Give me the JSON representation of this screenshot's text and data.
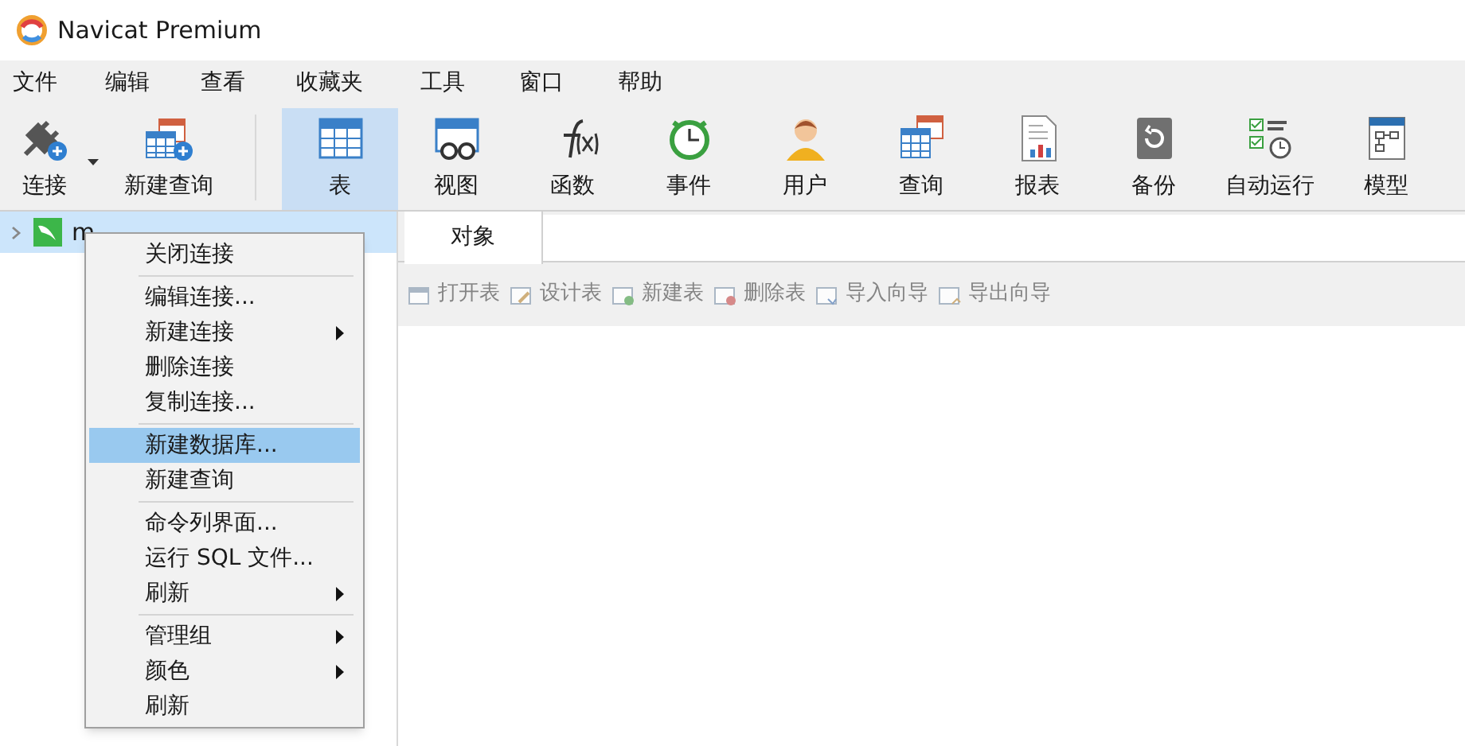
{
  "window": {
    "title": "Navicat Premium"
  },
  "menu_bar": [
    "文件",
    "编辑",
    "查看",
    "收藏夹",
    "工具",
    "窗口",
    "帮助"
  ],
  "toolbar_left": [
    {
      "label": "连接",
      "dropdown": true
    },
    {
      "label": "新建查询",
      "dropdown": false
    }
  ],
  "toolbar": [
    {
      "label": "表",
      "selected": true
    },
    {
      "label": "视图",
      "selected": false
    },
    {
      "label": "函数",
      "selected": false
    },
    {
      "label": "事件",
      "selected": false
    },
    {
      "label": "用户",
      "selected": false
    },
    {
      "label": "查询",
      "selected": false
    },
    {
      "label": "报表",
      "selected": false
    },
    {
      "label": "备份",
      "selected": false
    },
    {
      "label": "自动运行",
      "selected": false
    },
    {
      "label": "模型",
      "selected": false
    }
  ],
  "tree": [
    {
      "label": "m",
      "selected": true,
      "expanded": false
    }
  ],
  "tabs": [
    {
      "label": "对象",
      "selected": true
    }
  ],
  "object_toolbar": [
    {
      "label": "打开表",
      "disabled": true
    },
    {
      "label": "设计表",
      "disabled": true
    },
    {
      "label": "新建表",
      "disabled": true
    },
    {
      "label": "删除表",
      "disabled": true
    },
    {
      "label": "导入向导",
      "disabled": true
    },
    {
      "label": "导出向导",
      "disabled": true
    }
  ],
  "context_menu": [
    {
      "kind": "item",
      "label": "关闭连接",
      "submenu": false,
      "selected": false
    },
    {
      "kind": "separator"
    },
    {
      "kind": "item",
      "label": "编辑连接...",
      "submenu": false,
      "selected": false
    },
    {
      "kind": "item",
      "label": "新建连接",
      "submenu": true,
      "selected": false
    },
    {
      "kind": "item",
      "label": "删除连接",
      "submenu": false,
      "selected": false
    },
    {
      "kind": "item",
      "label": "复制连接...",
      "submenu": false,
      "selected": false
    },
    {
      "kind": "separator"
    },
    {
      "kind": "item",
      "label": "新建数据库...",
      "submenu": false,
      "selected": true
    },
    {
      "kind": "item",
      "label": "新建查询",
      "submenu": false,
      "selected": false
    },
    {
      "kind": "separator"
    },
    {
      "kind": "item",
      "label": "命令列界面...",
      "submenu": false,
      "selected": false
    },
    {
      "kind": "item",
      "label": "运行 SQL 文件...",
      "submenu": false,
      "selected": false
    },
    {
      "kind": "item",
      "label": "刷新",
      "submenu": true,
      "selected": false
    },
    {
      "kind": "separator"
    },
    {
      "kind": "item",
      "label": "管理组",
      "submenu": true,
      "selected": false
    },
    {
      "kind": "item",
      "label": "颜色",
      "submenu": true,
      "selected": false
    },
    {
      "kind": "item",
      "label": "刷新",
      "submenu": false,
      "selected": false
    }
  ]
}
